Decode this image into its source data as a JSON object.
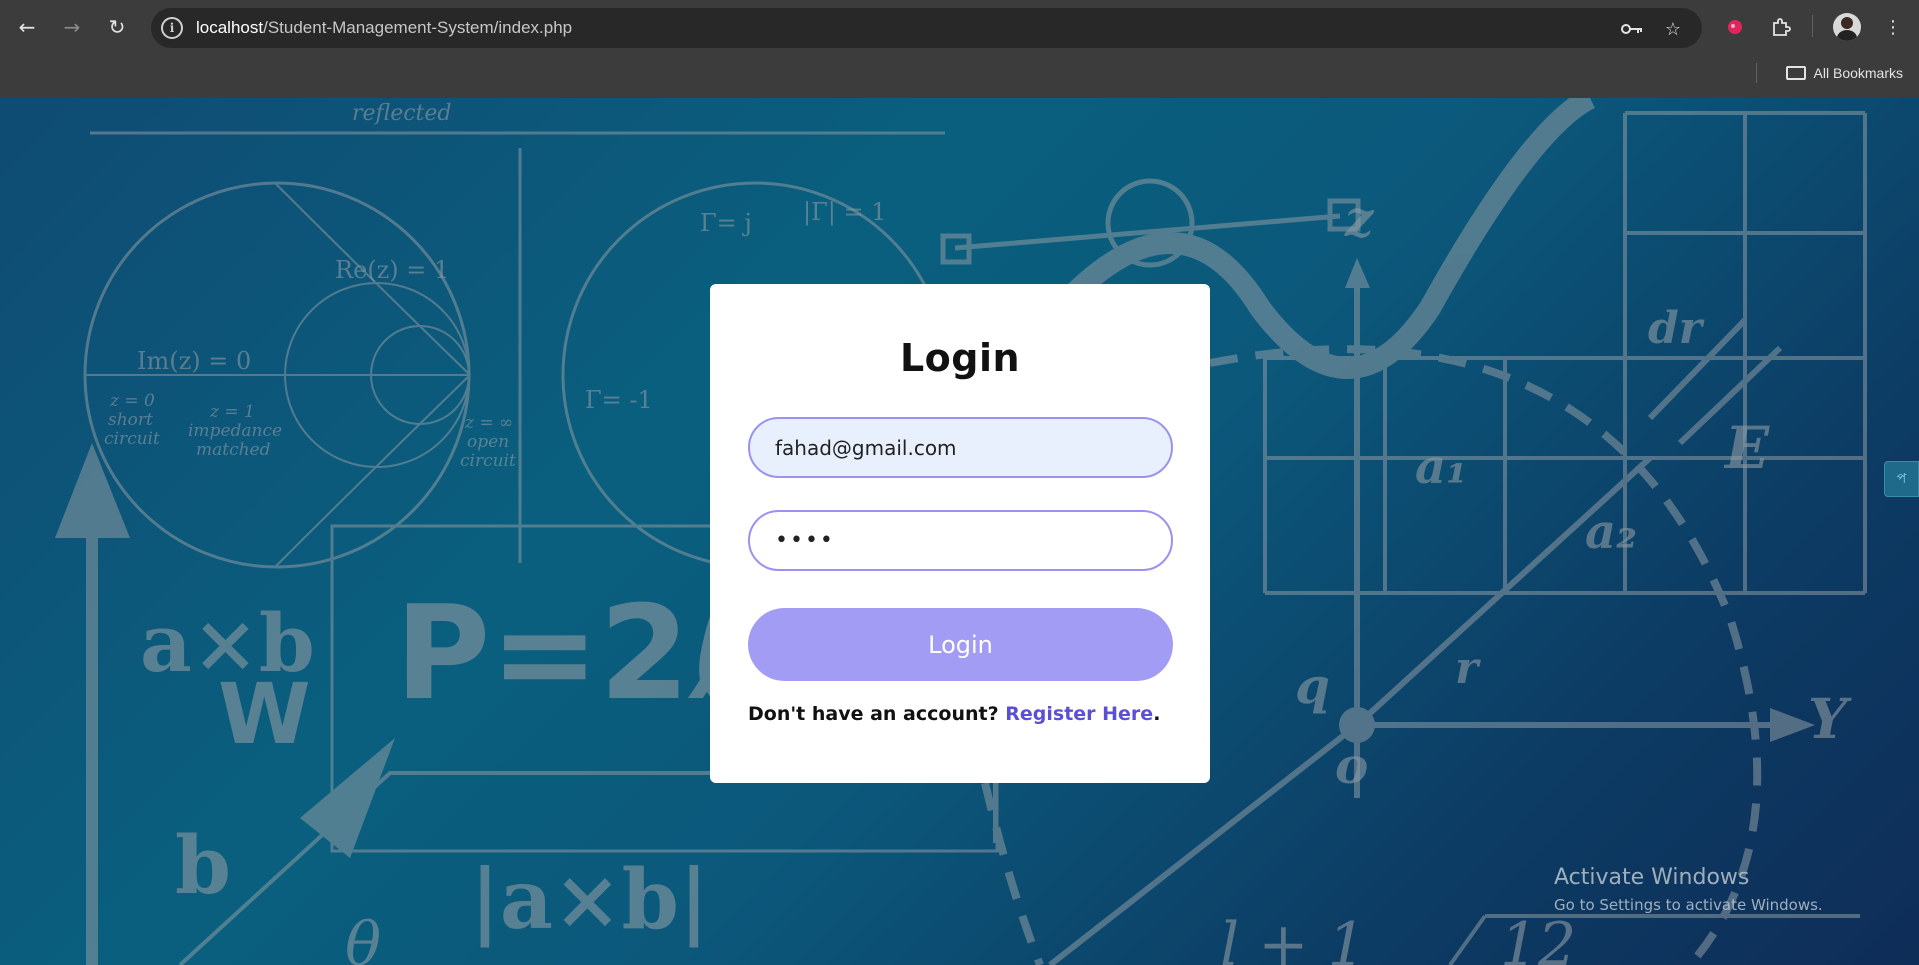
{
  "browser": {
    "url_host": "localhost",
    "url_path": "/Student-Management-System/index.php",
    "bookmarks_label": "All Bookmarks"
  },
  "icons": [
    "back-icon",
    "forward-icon",
    "reload-icon",
    "site-info-icon",
    "key-icon",
    "star-icon",
    "extension-icon",
    "puzzle-icon",
    "avatar",
    "menu-icon",
    "folder-icon"
  ],
  "login": {
    "title": "Login",
    "email_value": "fahad@gmail.com",
    "password_value": "••••",
    "button_label": "Login",
    "register_prompt": "Don't have an account?",
    "register_link": "Register Here",
    "register_suffix": "."
  },
  "side_tab_label": "প",
  "watermark": {
    "title": "Activate Windows",
    "subtitle": "Go to Settings to activate Windows."
  },
  "colors": {
    "accent": "#a39cf5",
    "link": "#5b4fd6",
    "field_border": "#9b92f0"
  }
}
